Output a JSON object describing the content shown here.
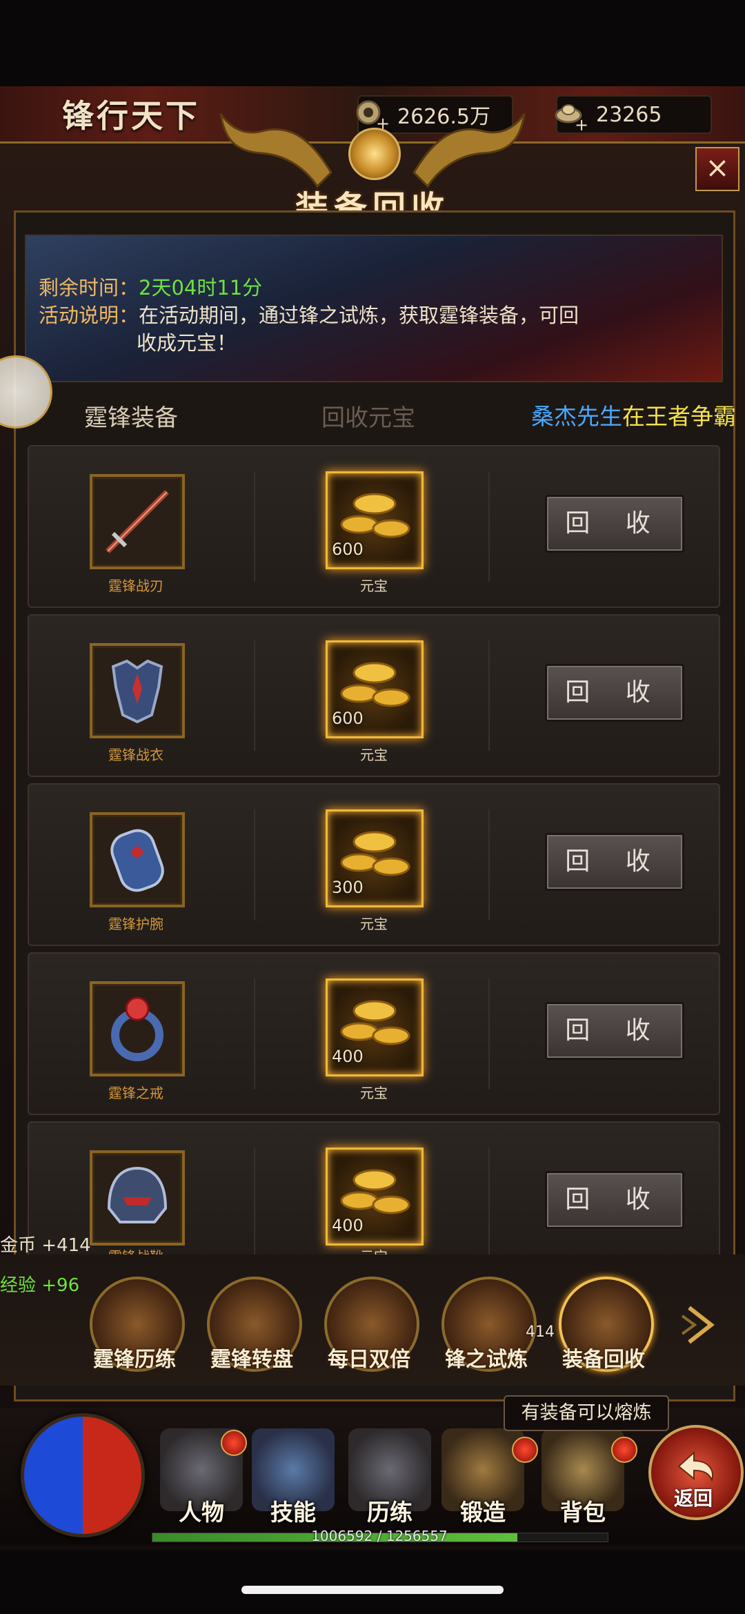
{
  "header": {
    "game_title": "锋行天下",
    "coins": "2626.5万",
    "yuanbao": "23265",
    "close_glyph": "×"
  },
  "panel": {
    "title": "装备回收",
    "remaining_label": "剩余时间：",
    "remaining_value": "2天04时11分",
    "desc_label": "活动说明：",
    "desc_line1": "在活动期间，通过锋之试炼，获取霆锋装备，可回",
    "desc_line2": "收成元宝！"
  },
  "columns": {
    "equipment": "霆锋装备",
    "reward": "回收元宝"
  },
  "marquee": {
    "name": "桑杰先生",
    "text": "在王者争霸"
  },
  "rows": [
    {
      "item": "霆锋战刃",
      "amount": "600",
      "reward_name": "元宝",
      "button": "回 收"
    },
    {
      "item": "霆锋战衣",
      "amount": "600",
      "reward_name": "元宝",
      "button": "回 收"
    },
    {
      "item": "霆锋护腕",
      "amount": "300",
      "reward_name": "元宝",
      "button": "回 收"
    },
    {
      "item": "霆锋之戒",
      "amount": "400",
      "reward_name": "元宝",
      "button": "回 收"
    },
    {
      "item": "霆锋战靴",
      "amount": "400",
      "reward_name": "元宝",
      "button": "回 收"
    }
  ],
  "floating": {
    "gold": "金币  +414",
    "exp": "经验  +96",
    "num": "414"
  },
  "activities": [
    {
      "label": "霆锋历练"
    },
    {
      "label": "霆锋转盘"
    },
    {
      "label": "每日双倍"
    },
    {
      "label": "锋之试炼"
    },
    {
      "label": "装备回收"
    }
  ],
  "tooltip": "有装备可以熔炼",
  "nav": [
    {
      "label": "人物"
    },
    {
      "label": "技能"
    },
    {
      "label": "历练"
    },
    {
      "label": "锻造"
    },
    {
      "label": "背包"
    }
  ],
  "back_label": "返回",
  "exp_text": "1006592 / 1256557",
  "exp_fraction": 0.801,
  "colors": {
    "accent_gold": "#d8a84a",
    "time_green": "#6ee33e",
    "marquee_blue": "#4aa8ff",
    "marquee_yellow": "#f4e24a"
  }
}
